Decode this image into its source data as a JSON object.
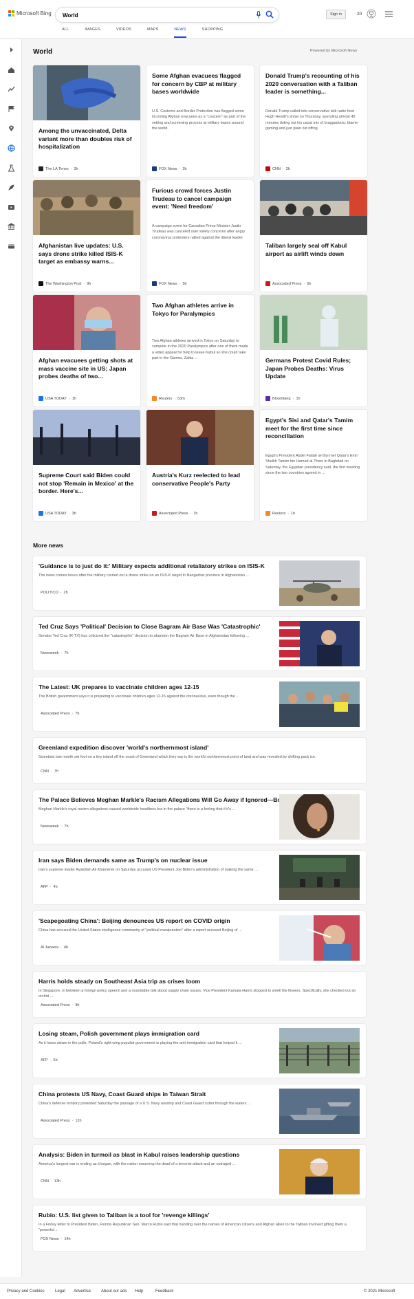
{
  "header": {
    "logo_text": "Microsoft Bing",
    "search_value": "World",
    "signin_label": "Sign in",
    "rewards_count": "20",
    "tabs": [
      {
        "label": "ALL",
        "active": false
      },
      {
        "label": "IMAGES",
        "active": false
      },
      {
        "label": "VIDEOS",
        "active": false
      },
      {
        "label": "MAPS",
        "active": false
      },
      {
        "label": "NEWS",
        "active": true
      },
      {
        "label": "SHOPPING",
        "active": false
      }
    ]
  },
  "sidebar": {
    "icons": [
      "expand-arrow-icon",
      "home-icon",
      "trending-icon",
      "flag-icon",
      "location-pin-icon",
      "globe-icon",
      "science-icon",
      "rocket-icon",
      "entertainment-icon",
      "money-icon",
      "card-icon"
    ]
  },
  "section": {
    "title": "World",
    "powered_by": "Powered by Microsoft News"
  },
  "cards": [
    {
      "title": "Among the unvaccinated, Delta variant more than doubles risk of hospitalization",
      "snippet": "",
      "source": "The LA Times",
      "age": "3h",
      "logo_color": "#222",
      "has_image": true,
      "image": "gloves-icon"
    },
    {
      "title": "Some Afghan evacuees flagged for concern by CBP at military bases worldwide",
      "snippet": "U.S. Customs and Border Protection has flagged some incoming Afghan evacuees as a \"concern\" as part of the vetting and screening process at military bases around the world.",
      "source": "FOX News",
      "age": "3h",
      "logo_color": "#1a3a7a",
      "has_image": false
    },
    {
      "title": "Donald Trump's recounting of his 2020 conversation with a Taliban leader is something...",
      "snippet": "Donald Trump called into conservative talk radio host Hugh Hewitt's show on Thursday, spending almost 45 minutes doling out his usual mix of braggadocio, blame-gaming and just plain old riffing.",
      "source": "CNN",
      "age": "2h",
      "logo_color": "#cc0000",
      "has_image": false
    },
    {
      "title": "Afghanistan live updates: U.S. says drone strike killed ISIS-K target as embassy warns...",
      "snippet": "",
      "source": "The Washington Post",
      "age": "9h",
      "logo_color": "#111",
      "has_image": true,
      "image": "soldiers-icon"
    },
    {
      "title": "Furious crowd forces Justin Trudeau to cancel campaign event: 'Need freedom'",
      "snippet": "A campaign event for Canadian Prime Minister Justin Trudeau was canceled over safety concerns after angry coronavirus protesters rallied against the liberal leader.",
      "source": "FOX News",
      "age": "5h",
      "logo_color": "#1a3a7a",
      "has_image": false
    },
    {
      "title": "Taliban largely seal off Kabul airport as airlift winds down",
      "snippet": "",
      "source": "Associated Press",
      "age": "6h",
      "logo_color": "#cc1a1a",
      "has_image": true,
      "image": "crowd-icon"
    },
    {
      "title": "Afghan evacuees getting shots at mass vaccine site in US; Japan probes deaths of two...",
      "snippet": "",
      "source": "USA TODAY",
      "age": "1h",
      "logo_color": "#1a73e8",
      "has_image": true,
      "image": "vaccine-icon"
    },
    {
      "title": "Two Afghan athletes arrive in Tokyo for Paralympics",
      "snippet": "Two Afghan athletes arrived in Tokyo on Saturday to compete in the 2020 Paralympics after one of them made a video appeal for help to leave Kabul so she could take part in the Games. Zakia ...",
      "source": "Reuters",
      "age": "53m",
      "logo_color": "#f08a24",
      "has_image": false
    },
    {
      "title": "Germans Protest Covid Rules; Japan Probes Deaths: Virus Update",
      "snippet": "",
      "source": "Bloomberg",
      "age": "1h",
      "logo_color": "#5a2ea6",
      "has_image": true,
      "image": "hospital-icon"
    },
    {
      "title": "Supreme Court said Biden could not stop 'Remain in Mexico' at the border. Here's...",
      "snippet": "",
      "source": "USA TODAY",
      "age": "3h",
      "logo_color": "#1a73e8",
      "has_image": true,
      "image": "border-icon"
    },
    {
      "title": "Austria's Kurz reelected to lead conservative People's Party",
      "snippet": "",
      "source": "Associated Press",
      "age": "1h",
      "logo_color": "#cc1a1a",
      "has_image": true,
      "image": "politician-icon"
    },
    {
      "title": "Egypt's Sisi and Qatar's Tamim meet for the first time since reconciliation",
      "snippet": "Egypt's President Abdel Fattah al-Sisi met Qatar's Emir Sheikh Tamim bin Hamad al-Thani in Baghdad on Saturday, the Egyptian presidency said, the first meeting since the two countries agreed in ...",
      "source": "Reuters",
      "age": "1h",
      "logo_color": "#f08a24",
      "has_image": false
    }
  ],
  "more_news": {
    "title": "More news",
    "items": [
      {
        "title": "'Guidance is to just do it:' Military expects additional retaliatory strikes on ISIS-K",
        "snippet": "The news comes hours after the military carried out a drone strike on an ISIS-K target in Nangarhar province in Afghanistan ...",
        "source": "POLITICO",
        "age": "2h",
        "logo_color": "#d11a2a",
        "has_image": true,
        "image": "helicopter-icon"
      },
      {
        "title": "Ted Cruz Says 'Political' Decision to Close Bagram Air Base Was 'Catastrophic'",
        "snippet": "Senator Ted Cruz (R-TX) has criticized the \"catastrophic\" decision to abandon the Bagram Air Base in Afghanistan following ...",
        "source": "Newsweek",
        "age": "7h",
        "logo_color": "#d0021b",
        "has_image": true,
        "image": "senator-icon"
      },
      {
        "title": "The Latest: UK prepares to vaccinate children ages 12-15",
        "snippet": "The British government says it is preparing to vaccinate children ages 12-15 against the coronavirus, even though the ...",
        "source": "Associated Press",
        "age": "7h",
        "logo_color": "#cc1a1a",
        "has_image": true,
        "image": "protest-icon"
      },
      {
        "title": "Greenland expedition discover 'world's northernmost island'",
        "snippet": "Scientists last month set foot on a tiny island off the coast of Greenland which they say is the world's northernmost point of land and was revealed by shifting pack ice.",
        "source": "CNN",
        "age": "7h",
        "logo_color": "#cc0000",
        "has_image": false
      },
      {
        "title": "The Palace Believes Meghan Markle's Racism Allegations Will Go Away if Ignored—Book",
        "snippet": "Meghan Markle's royal racism allegations caused worldwide headlines but in the palace \"there is a feeling that if it's ...",
        "source": "Newsweek",
        "age": "7h",
        "logo_color": "#d0021b",
        "has_image": true,
        "image": "portrait-icon"
      },
      {
        "title": "Iran says Biden demands same as Trump's on nuclear issue",
        "snippet": "Iran's supreme leader Ayatollah Ali Khamenei on Saturday accused US President Joe Biden's administration of making the same ...",
        "source": "AFP",
        "age": "4h",
        "logo_color": "#1a73e8",
        "has_image": true,
        "image": "assembly-icon"
      },
      {
        "title": "'Scapegoating China': Beijing denounces US report on COVID origin",
        "snippet": "China has accused the United States intelligence community of \"political manipulation\" after a report accused Beijing of ...",
        "source": "Al Jazeera",
        "age": "4h",
        "logo_color": "#f5a623",
        "has_image": true,
        "image": "swab-icon"
      },
      {
        "title": "Harris holds steady on Southeast Asia trip as crises loom",
        "snippet": "In Singapore, in between a foreign policy speech and a roundtable talk about supply chain issues, Vice President Kamala Harris stopped to smell the flowers. Specifically, she checked out an orchid ...",
        "source": "Associated Press",
        "age": "9h",
        "logo_color": "#cc1a1a",
        "has_image": false
      },
      {
        "title": "Losing steam, Polish government plays immigration card",
        "snippet": "As it loses steam in the polls, Poland's right-wing populist government is playing the anti-immigration card that helped it ...",
        "source": "AFP",
        "age": "6h",
        "logo_color": "#1a73e8",
        "has_image": true,
        "image": "fence-icon"
      },
      {
        "title": "China protests US Navy, Coast Guard ships in Taiwan Strait",
        "snippet": "China's defense ministry protested Saturday the passage of a U.S. Navy warship and Coast Guard cutter through the waters ...",
        "source": "Associated Press",
        "age": "12h",
        "logo_color": "#cc1a1a",
        "has_image": true,
        "image": "ship-icon"
      },
      {
        "title": "Analysis: Biden in turmoil as blast in Kabul raises leadership questions",
        "snippet": "America's longest war is ending as it began, with the nation mourning the dead of a terrorist attack and an outraged ...",
        "source": "CNN",
        "age": "13h",
        "logo_color": "#cc0000",
        "has_image": true,
        "image": "president-icon"
      },
      {
        "title": "Rubio: U.S. list given to Taliban is a tool for 'revenge killings'",
        "snippet": "In a Friday letter to President Biden, Florida Republican Sen. Marco Rubio said that handing over the names of American citizens and Afghan allies to the Taliban involved gifting them a \"powerful ...",
        "source": "FOX News",
        "age": "14h",
        "logo_color": "#1a3a7a",
        "has_image": false
      }
    ]
  },
  "footer": {
    "links": [
      "Privacy and Cookies",
      "Legal",
      "Advertise",
      "About our ads",
      "Help",
      "Feedback"
    ],
    "copyright": "© 2021 Microsoft"
  }
}
